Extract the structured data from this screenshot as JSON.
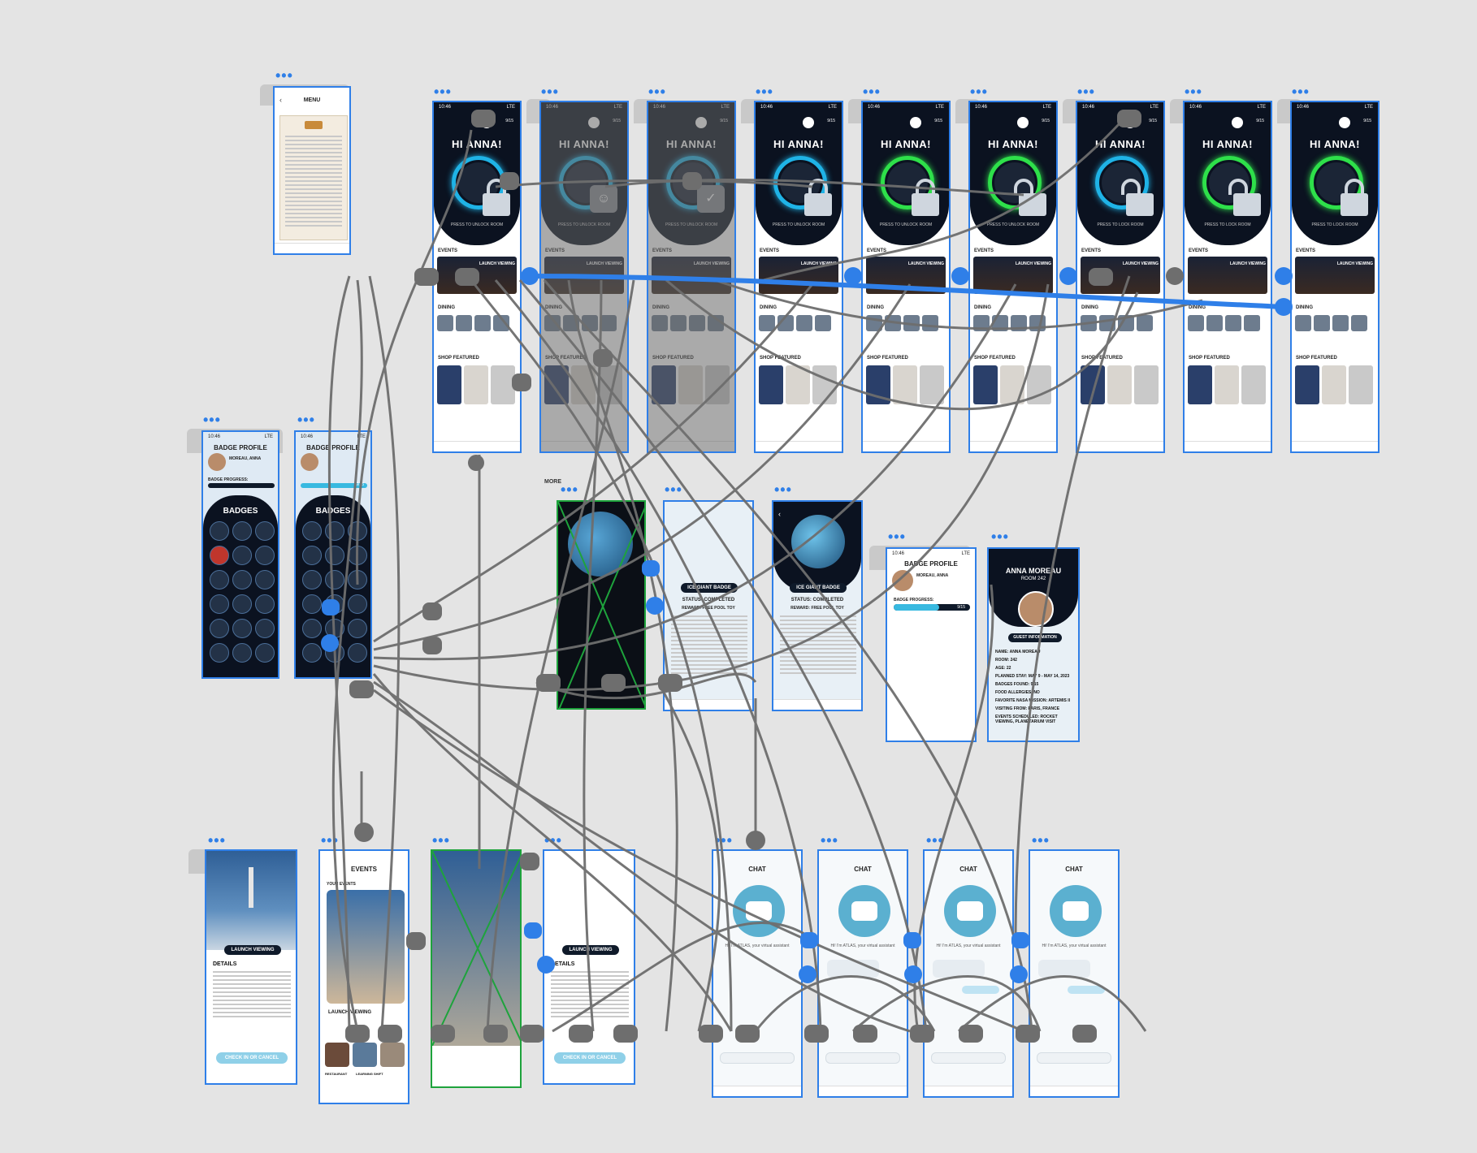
{
  "status": {
    "time": "10:46",
    "signal": "LTE"
  },
  "home": {
    "greeting": "HI ANNA!",
    "unlock_hint": "PRESS TO UNLOCK ROOM",
    "lock_hint": "PRESS TO LOCK ROOM",
    "events_label": "EVENTS",
    "event_card": "LAUNCH VIEWING",
    "dining_label": "DINING",
    "shop_label": "SHOP FEATURED",
    "badge_count": "9/15"
  },
  "menu": {
    "title": "MENU"
  },
  "more_label": "MORE",
  "badges": {
    "profile_title": "BADGE PROFILE",
    "name": "MOREAU, ANNA",
    "progress_label": "BADGE PROGRESS:",
    "progress_value": "9/15",
    "title": "BADGES"
  },
  "ice_badge": {
    "title": "ICE GIANT BADGE",
    "status": "STATUS: COMPLETED",
    "reward": "REWARD: FREE POOL TOY"
  },
  "guest": {
    "name": "ANNA MOREAU",
    "room": "ROOM 242",
    "info_title": "GUEST INFORMATION",
    "lines": [
      "NAME: ANNA MOREAU",
      "ROOM: 242",
      "AGE: 22",
      "PLANNED STAY: MAY 9 - MAY 14, 2023",
      "BADGES FOUND: 9/15",
      "FOOD ALLERGIES: NO",
      "FAVORITE NASA MISSION: ARTEMIS II",
      "VISITING FROM: PARIS, FRANCE",
      "EVENTS SCHEDULED: ROCKET VIEWING, PLANETARIUM VISIT"
    ]
  },
  "launch": {
    "title": "LAUNCH VIEWING",
    "details": "DETAILS",
    "button": "CHECK IN OR CANCEL"
  },
  "events_screen": {
    "title": "EVENTS",
    "your_events": "YOUR EVENTS",
    "card": "LAUNCH VIEWING",
    "cats": [
      "RESTAURANT",
      "LEARNING SHIFT"
    ]
  },
  "chat": {
    "title": "CHAT",
    "greeting": "Hi! I'm ATLAS, your virtual assistant"
  },
  "colors": {
    "accent": "#2f7fe8",
    "wire": "#6e6e6e",
    "unlock_blue": "#1fb3e6",
    "unlock_green": "#2ee04a"
  }
}
